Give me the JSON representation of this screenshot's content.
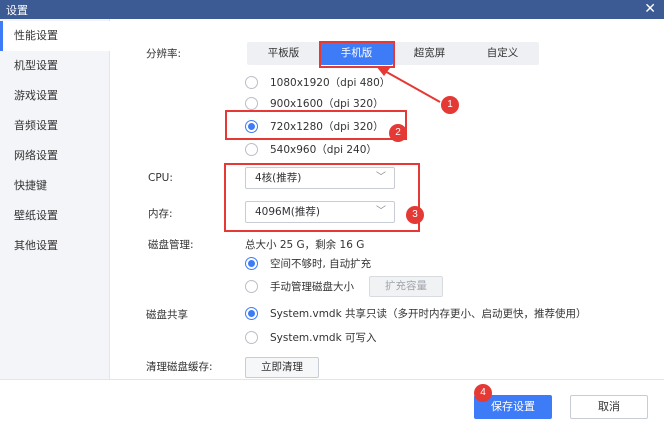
{
  "window": {
    "title": "设置",
    "close_glyph": "✕"
  },
  "sidebar": {
    "items": [
      {
        "label": "性能设置",
        "active": true
      },
      {
        "label": "机型设置"
      },
      {
        "label": "游戏设置"
      },
      {
        "label": "音频设置"
      },
      {
        "label": "网络设置"
      },
      {
        "label": "快捷键"
      },
      {
        "label": "壁纸设置"
      },
      {
        "label": "其他设置"
      }
    ]
  },
  "resolution": {
    "label": "分辨率:",
    "tabs": [
      {
        "label": "平板版"
      },
      {
        "label": "手机版",
        "active": true
      },
      {
        "label": "超宽屏"
      },
      {
        "label": "自定义"
      }
    ],
    "options": [
      {
        "label": "1080x1920（dpi 480）"
      },
      {
        "label": "900x1600（dpi 320）"
      },
      {
        "label": "720x1280（dpi 320）",
        "checked": true
      },
      {
        "label": "540x960（dpi 240）"
      }
    ]
  },
  "cpu": {
    "label": "CPU:",
    "value": "4核(推荐)"
  },
  "memory": {
    "label": "内存:",
    "value": "4096M(推荐)"
  },
  "disk": {
    "label": "磁盘管理:",
    "summary": "总大小 25 G，剩余 16 G",
    "options": [
      {
        "label": "空间不够时, 自动扩充",
        "checked": true
      },
      {
        "label": "手动管理磁盘大小"
      }
    ],
    "expand_button": "扩充容量"
  },
  "disk_share": {
    "label": "磁盘共享",
    "options": [
      {
        "label": "System.vmdk 共享只读（多开时内存更小、启动更快，推荐使用）",
        "checked": true
      },
      {
        "label": "System.vmdk 可写入"
      }
    ]
  },
  "cache": {
    "label": "清理磁盘缓存:",
    "button": "立即清理"
  },
  "footer": {
    "save": "保存设置",
    "cancel": "取消"
  },
  "annotations": {
    "badges": [
      "1",
      "2",
      "3",
      "4"
    ],
    "color": "#e53935"
  },
  "colors": {
    "accent": "#3d7bf7",
    "titlebar": "#3c5a93"
  }
}
